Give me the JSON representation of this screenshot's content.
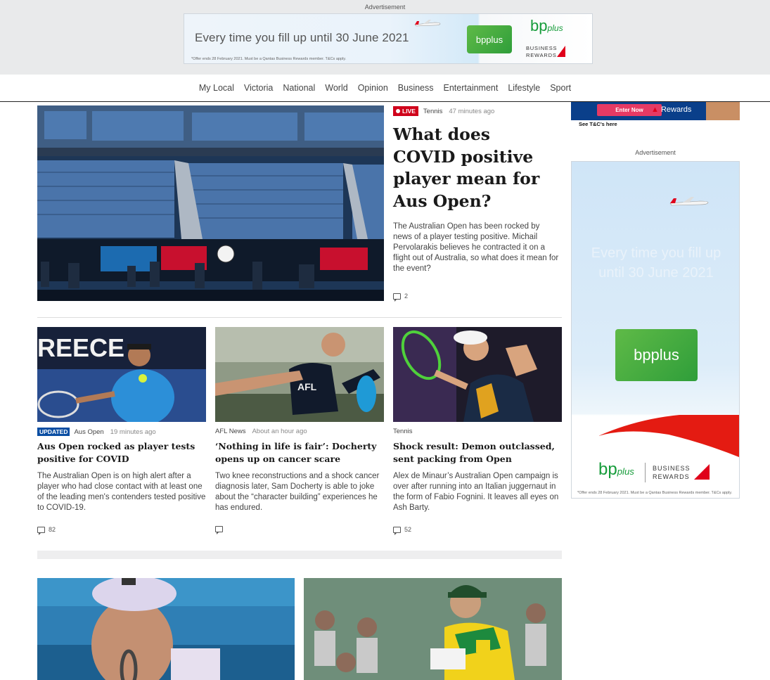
{
  "top_ad": {
    "label": "Advertisement",
    "text": "Every time you fill up until 30 June 2021",
    "fine_print": "*Offer ends 28 February 2021. Must be a Qantas Business Rewards member. T&Cs apply.",
    "bp_card": "bpplus",
    "bp_logo_main": "bp",
    "bp_logo_sub": "plus",
    "rewards_line1": "BUSINESS",
    "rewards_line2": "REWARDS"
  },
  "nav": {
    "items": [
      "My Local",
      "Victoria",
      "National",
      "World",
      "Opinion",
      "Business",
      "Entertainment",
      "Lifestyle",
      "Sport"
    ]
  },
  "hero": {
    "image_icon": "tennis-stadium-photo",
    "badge": "LIVE",
    "category": "Tennis",
    "time": "47 minutes ago",
    "headline": "What does COVID positive player mean for Aus Open?",
    "summary": "The Australian Open has been rocked by news of a player testing positive. Michail Pervolarakis believes he contracted it on a flight out of Australia, so what does it mean for the event?",
    "comments": "2"
  },
  "cards": [
    {
      "badge": "UPDATED",
      "category": "Aus Open",
      "time": "19 minutes ago",
      "headline": "Aus Open rocked as player tests positive for COVID",
      "summary": "The Australian Open is on high alert after a player who had close contact with at least one of the leading men's contenders tested positive to COVID-19.",
      "comments": "82",
      "image_text": "REECE"
    },
    {
      "category": "AFL News",
      "time": "About an hour ago",
      "headline": "‘Nothing in life is fair’: Docherty opens up on cancer scare",
      "summary": "Two knee reconstructions and a shock cancer diagnosis later, Sam Docherty is able to joke about the “character building” experiences he has endured.",
      "comments": ""
    },
    {
      "category": "Tennis",
      "headline": "Shock result: Demon outclassed, sent packing from Open",
      "summary": "Alex de Minaur’s Australian Open campaign is over after running into an Italian juggernaut in the form of Fabio Fognini. It leaves all eyes on Ash Barty.",
      "comments": "52"
    }
  ],
  "sidebar": {
    "enter_now": "Enter Now",
    "rewards": "Rewards",
    "tc_link": "See T&C's here",
    "ad_label": "Advertisement",
    "ad_text": "Every time you fill up until 30 June 2021",
    "bp_card": "bpplus",
    "bp_logo_main": "bp",
    "bp_logo_sub": "plus",
    "rewards_line1": "BUSINESS",
    "rewards_line2": "REWARDS",
    "fine_print": "*Offer ends 28 February 2021. Must be a Qantas Business Rewards member. T&Cs apply."
  },
  "colors": {
    "live": "#d0021b",
    "updated": "#0a4ea3",
    "bp_green": "#169c3a",
    "qantas_red": "#e0001b"
  }
}
